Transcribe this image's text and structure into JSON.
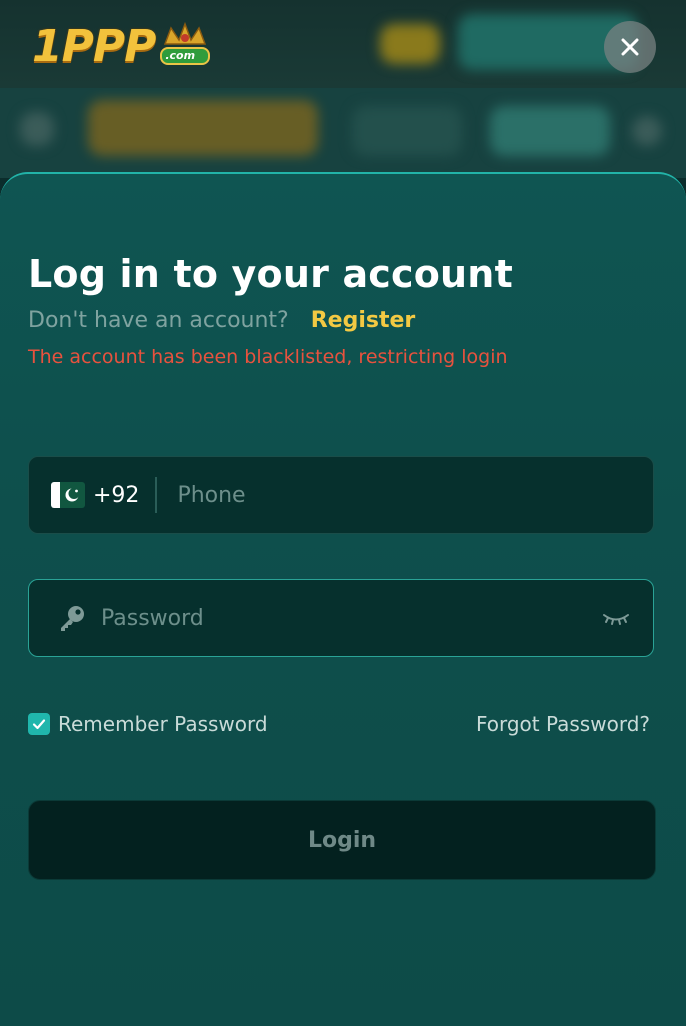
{
  "brand": {
    "logo_text": "1PPP",
    "logo_suffix": ".com"
  },
  "close_label": "×",
  "login": {
    "title": "Log in to your account",
    "no_account_text": "Don't have an account?",
    "register_label": "Register",
    "error_message": "The account has been blacklisted, restricting login",
    "phone": {
      "country_code": "+92",
      "placeholder": "Phone",
      "value": "",
      "flag": "pakistan-flag"
    },
    "password": {
      "placeholder": "Password",
      "value": ""
    },
    "remember_label": "Remember Password",
    "remember_checked": true,
    "forgot_label": "Forgot Password?",
    "submit_label": "Login"
  },
  "colors": {
    "accent": "#20b6ac",
    "register": "#f3c943",
    "error": "#e8523e",
    "modal_bg": "#0f5552"
  }
}
